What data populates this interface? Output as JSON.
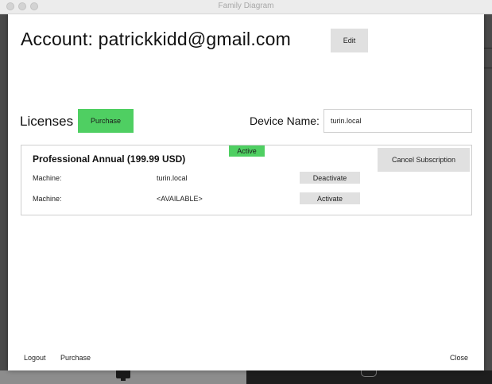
{
  "window": {
    "title": "Family Diagram"
  },
  "account": {
    "title": "Account: patrickkidd@gmail.com",
    "edit_label": "Edit"
  },
  "licenses": {
    "label": "Licenses",
    "purchase_label": "Purchase"
  },
  "device": {
    "label": "Device Name:",
    "value": "turin.local"
  },
  "license_card": {
    "plan_name": "Professional Annual (199.99 USD)",
    "status": "Active",
    "cancel_label": "Cancel Subscription",
    "machines": [
      {
        "label": "Machine:",
        "value": "turin.local",
        "action": "Deactivate"
      },
      {
        "label": "Machine:",
        "value": "<AVAILABLE>",
        "action": "Activate"
      }
    ]
  },
  "footer": {
    "logout": "Logout",
    "purchase": "Purchase",
    "close": "Close"
  },
  "colors": {
    "accent_green": "#4fcf62",
    "button_gray": "#e0e0e0"
  }
}
